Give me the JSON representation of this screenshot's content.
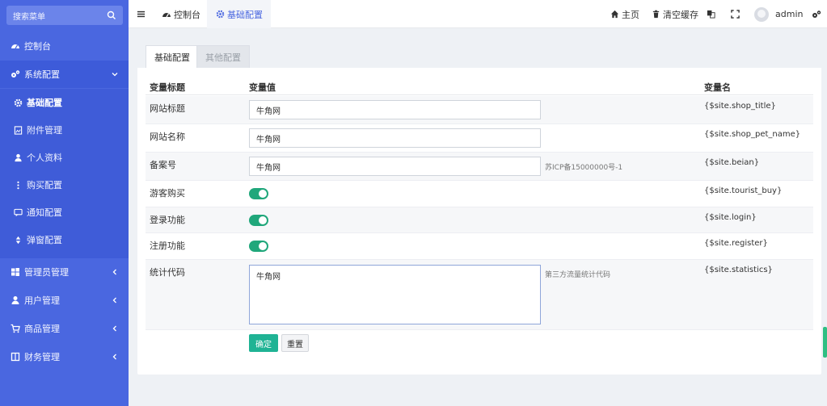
{
  "sidebar": {
    "search_placeholder": "搜索菜单",
    "items": [
      {
        "label": "控制台",
        "icon": "dashboard-icon"
      },
      {
        "label": "系统配置",
        "icon": "cogs-icon"
      },
      {
        "label": "管理员管理",
        "icon": "windows-icon"
      },
      {
        "label": "用户管理",
        "icon": "user-icon"
      },
      {
        "label": "商品管理",
        "icon": "cart-icon"
      },
      {
        "label": "财务管理",
        "icon": "book-icon"
      }
    ],
    "submenu": [
      {
        "label": "基础配置",
        "icon": "cog-icon"
      },
      {
        "label": "附件管理",
        "icon": "file-image-icon"
      },
      {
        "label": "个人资料",
        "icon": "user-icon"
      },
      {
        "label": "购买配置",
        "icon": "ellipsis-v-icon"
      },
      {
        "label": "通知配置",
        "icon": "comment-icon"
      },
      {
        "label": "弹窗配置",
        "icon": "sort-icon"
      }
    ]
  },
  "topbar": {
    "menu_icon": "bars-icon",
    "tab_console": "控制台",
    "tab_basic": "基础配置",
    "home": "主页",
    "clear_cache": "清空缓存",
    "username": "admin"
  },
  "tabs": [
    "基础配置",
    "其他配置"
  ],
  "table": {
    "headers": [
      "变量标题",
      "变量值",
      "变量名"
    ],
    "rows": [
      {
        "title": "网站标题",
        "type": "text",
        "value": "牛角网",
        "var": "{$site.shop_title}"
      },
      {
        "title": "网站名称",
        "type": "text",
        "value": "牛角网",
        "var": "{$site.shop_pet_name}"
      },
      {
        "title": "备案号",
        "type": "text",
        "value": "牛角网",
        "hint": "苏ICP备15000000号-1",
        "var": "{$site.beian}"
      },
      {
        "title": "游客购买",
        "type": "toggle",
        "value": true,
        "var": "{$site.tourist_buy}"
      },
      {
        "title": "登录功能",
        "type": "toggle",
        "value": true,
        "var": "{$site.login}"
      },
      {
        "title": "注册功能",
        "type": "toggle",
        "value": true,
        "var": "{$site.register}"
      },
      {
        "title": "统计代码",
        "type": "textarea",
        "value": "牛角网",
        "hint": "第三方流量统计代码",
        "var": "{$site.statistics}"
      }
    ]
  },
  "buttons": {
    "submit": "确定",
    "reset": "重置"
  },
  "colors": {
    "sidebar": "#4a67e0",
    "accent": "#20a77b",
    "primary_button": "#1fb394"
  }
}
